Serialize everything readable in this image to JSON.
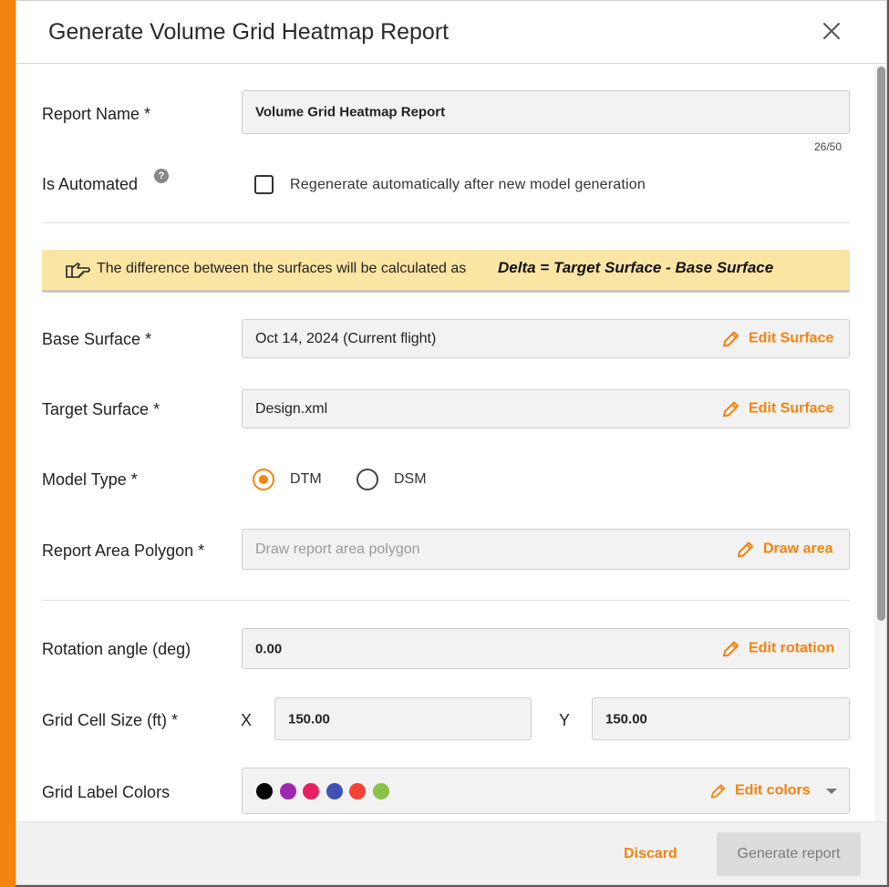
{
  "dialog": {
    "title": "Generate Volume Grid Heatmap Report"
  },
  "report_name": {
    "label": "Report Name *",
    "value": "Volume Grid Heatmap Report",
    "counter": "26/50"
  },
  "is_automated": {
    "label": "Is Automated",
    "help": "?",
    "checkbox_label": "Regenerate automatically after new model generation",
    "checked": false
  },
  "info_banner": {
    "text": "The difference between the surfaces will be calculated as",
    "formula": "Delta = Target Surface - Base Surface"
  },
  "base_surface": {
    "label": "Base Surface *",
    "value": "Oct 14, 2024  (Current flight)",
    "action": "Edit Surface"
  },
  "target_surface": {
    "label": "Target Surface *",
    "value": "Design.xml",
    "action": "Edit Surface"
  },
  "model_type": {
    "label": "Model Type *",
    "options": [
      "DTM",
      "DSM"
    ],
    "selected": "DTM"
  },
  "report_area": {
    "label": "Report Area Polygon *",
    "placeholder": "Draw report area polygon",
    "action": "Draw area"
  },
  "rotation": {
    "label": "Rotation angle (deg)",
    "value": "0.00",
    "action": "Edit rotation"
  },
  "grid_cell_size": {
    "label": "Grid Cell Size (ft) *",
    "x_label": "X",
    "x_value": "150.00",
    "y_label": "Y",
    "y_value": "150.00"
  },
  "grid_label_colors": {
    "label": "Grid Label Colors",
    "colors": [
      "#000000",
      "#9c27b0",
      "#e91e63",
      "#3f51b5",
      "#f44336",
      "#8bc34a"
    ],
    "action": "Edit colors"
  },
  "footer": {
    "discard": "Discard",
    "generate": "Generate report"
  },
  "theme": {
    "accent": "#f5830f"
  }
}
